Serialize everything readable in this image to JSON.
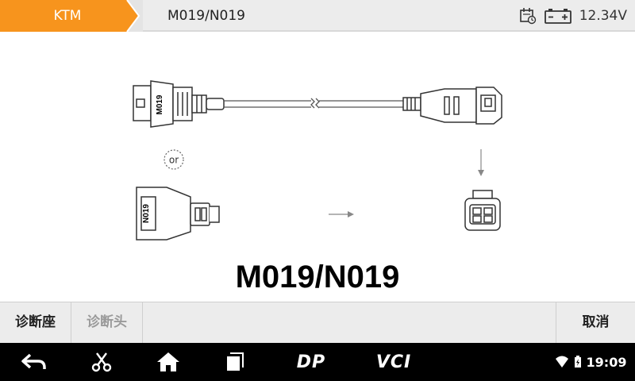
{
  "header": {
    "breadcrumb": [
      "KTM",
      "M019/N019"
    ],
    "voltage": "12.34V",
    "accent_color": "#f7941d"
  },
  "diagram": {
    "label_top_connector": "M019",
    "label_bottom_connector": "N019",
    "or_label": "or",
    "connector_title": "M019/N019"
  },
  "actions": {
    "diag_socket": "诊断座",
    "diag_head": "诊断头",
    "cancel": "取消"
  },
  "navbar": {
    "dp_label": "DP",
    "vci_label": "VCI",
    "time": "19:09"
  }
}
